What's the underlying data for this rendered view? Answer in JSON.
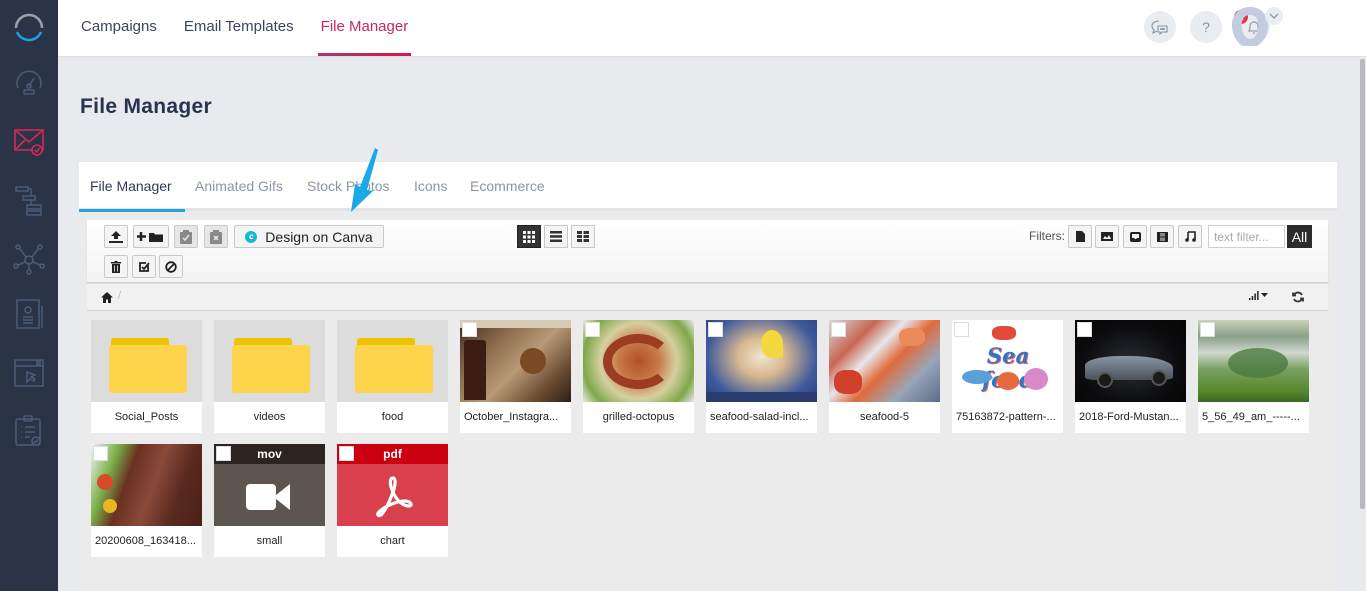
{
  "sidebar": {
    "items": [
      {
        "name": "dashboard",
        "icon": "speedometer-icon",
        "active": false
      },
      {
        "name": "email-marketing",
        "icon": "envelope-check-icon",
        "active": true
      },
      {
        "name": "automation",
        "icon": "workflow-icon",
        "active": false
      },
      {
        "name": "integrations",
        "icon": "network-hub-icon",
        "active": false
      },
      {
        "name": "contacts",
        "icon": "contact-card-icon",
        "active": false
      },
      {
        "name": "landing-pages",
        "icon": "browser-cursor-icon",
        "active": false
      },
      {
        "name": "forms",
        "icon": "clipboard-check-icon",
        "active": false
      }
    ]
  },
  "topnav": {
    "items": [
      "Campaigns",
      "Email Templates",
      "File Manager"
    ],
    "active": "File Manager"
  },
  "header": {
    "chat_icon": "chat-bubbles-icon",
    "help_label": "?",
    "notification_count": "1"
  },
  "page": {
    "title": "File Manager"
  },
  "tabs": [
    "File Manager",
    "Animated Gifs",
    "Stock Photos",
    "Icons",
    "Ecommerce"
  ],
  "toolbar": {
    "canva_label": "Design on Canva",
    "canva_logo": "c",
    "filters_label": "Filters:",
    "filter_placeholder": "text filter...",
    "all_label": "All",
    "view_modes": [
      "grid",
      "list",
      "details"
    ],
    "active_view": "grid"
  },
  "breadcrumb": {
    "separator": "/"
  },
  "files": [
    {
      "name": "Social_Posts",
      "type": "folder"
    },
    {
      "name": "videos",
      "type": "folder"
    },
    {
      "name": "food",
      "type": "folder"
    },
    {
      "name": "October_Instagra...",
      "type": "image"
    },
    {
      "name": "grilled-octopus",
      "type": "image"
    },
    {
      "name": "seafood-salad-incl...",
      "type": "image"
    },
    {
      "name": "seafood-5",
      "type": "image"
    },
    {
      "name": "75163872-pattern-...",
      "type": "image"
    },
    {
      "name": "2018-Ford-Mustan...",
      "type": "image"
    },
    {
      "name": "5_56_49_am_-----...",
      "type": "image"
    },
    {
      "name": "20200608_163418...",
      "type": "image"
    },
    {
      "name": "small",
      "type": "video",
      "ext": "mov"
    },
    {
      "name": "chart",
      "type": "pdf",
      "ext": "pdf"
    }
  ],
  "colors": {
    "sidebar_bg": "#2b3446",
    "accent_pink": "#c9285a",
    "tab_indicator": "#2ba2e0",
    "pdf_red": "#d9404e",
    "mov_brown": "#5e5450"
  }
}
